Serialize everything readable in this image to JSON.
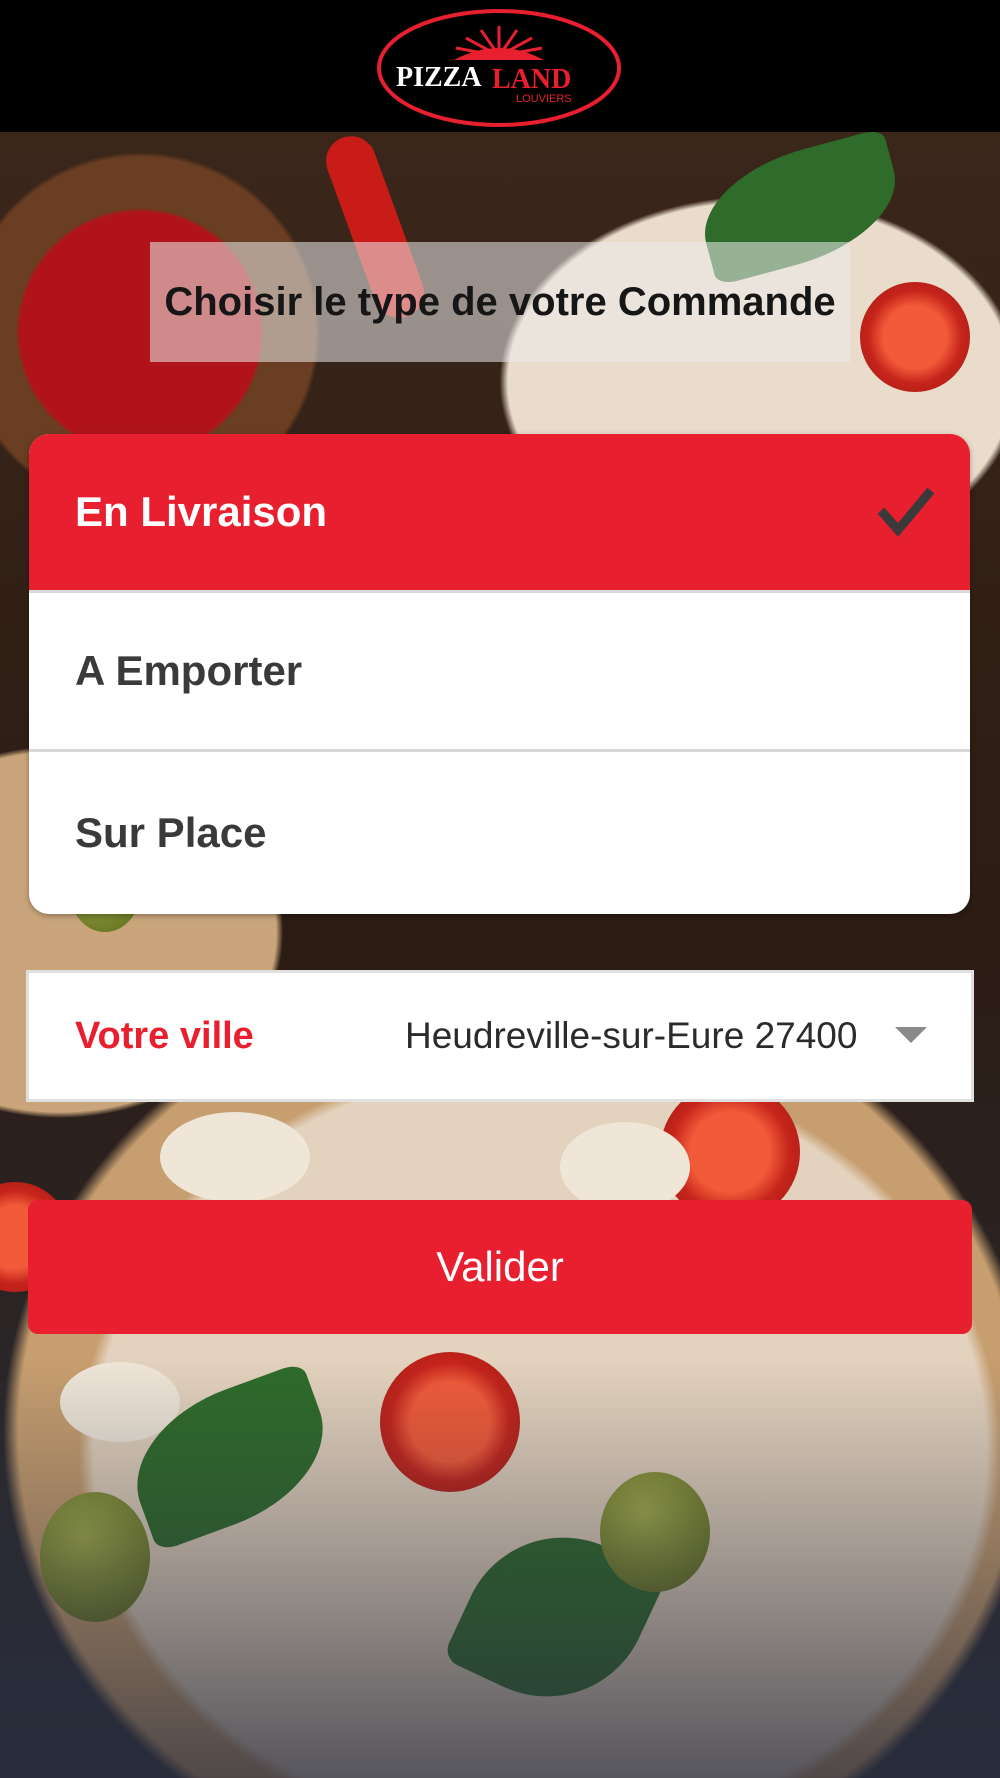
{
  "header": {
    "logo_word1": "PIZZA",
    "logo_word2": "LAND",
    "logo_sub": "LOUVIERS"
  },
  "title": "Choisir le type de votre Commande",
  "order_types": [
    {
      "label": "En Livraison",
      "selected": true
    },
    {
      "label": "A Emporter",
      "selected": false
    },
    {
      "label": "Sur Place",
      "selected": false
    }
  ],
  "city": {
    "label": "Votre ville",
    "value": "Heudreville-sur-Eure 27400"
  },
  "submit_label": "Valider",
  "colors": {
    "accent": "#e81f2e",
    "header_bg": "#000000",
    "check": "#3a3a3a"
  },
  "icons": {
    "selected_indicator": "check-icon",
    "dropdown": "chevron-down-icon"
  }
}
